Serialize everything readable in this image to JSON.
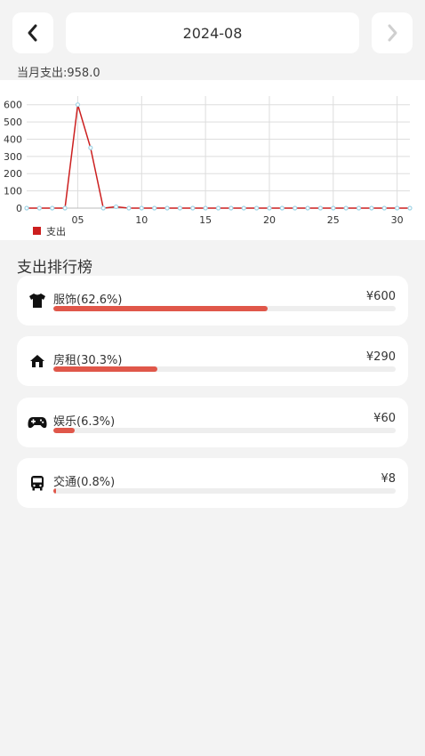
{
  "header": {
    "month": "2024-08"
  },
  "summary": {
    "total_text": "当月支出:958.0"
  },
  "chart_data": {
    "type": "line",
    "x": [
      1,
      2,
      3,
      4,
      5,
      6,
      7,
      8,
      9,
      10,
      11,
      12,
      13,
      14,
      15,
      16,
      17,
      18,
      19,
      20,
      21,
      22,
      23,
      24,
      25,
      26,
      27,
      28,
      29,
      30,
      31
    ],
    "series": [
      {
        "name": "支出",
        "values": [
          0,
          0,
          0,
          0,
          600,
          350,
          0,
          8,
          0,
          0,
          0,
          0,
          0,
          0,
          0,
          0,
          0,
          0,
          0,
          0,
          0,
          0,
          0,
          0,
          0,
          0,
          0,
          0,
          0,
          0,
          0
        ]
      }
    ],
    "xticks": [
      "05",
      "10",
      "15",
      "20",
      "25",
      "30"
    ],
    "yticks": [
      "0",
      "100",
      "200",
      "300",
      "400",
      "500",
      "600"
    ],
    "ylim": [
      0,
      650
    ],
    "xlim": [
      1,
      31
    ],
    "grid": true,
    "legend_position": "bottom-left",
    "line_color": "#cc1f1f",
    "point_color": "#9fd4e6"
  },
  "ranking": {
    "title": "支出排行榜",
    "currency": "¥",
    "items": [
      {
        "icon": "shirt-icon",
        "label": "服饰(62.6%)",
        "amount": "¥600",
        "percent": 62.6
      },
      {
        "icon": "home-icon",
        "label": "房租(30.3%)",
        "amount": "¥290",
        "percent": 30.3
      },
      {
        "icon": "gamepad-icon",
        "label": "娱乐(6.3%)",
        "amount": "¥60",
        "percent": 6.3
      },
      {
        "icon": "bus-icon",
        "label": "交通(0.8%)",
        "amount": "¥8",
        "percent": 0.8
      }
    ],
    "bar_color": "#e0574a"
  }
}
